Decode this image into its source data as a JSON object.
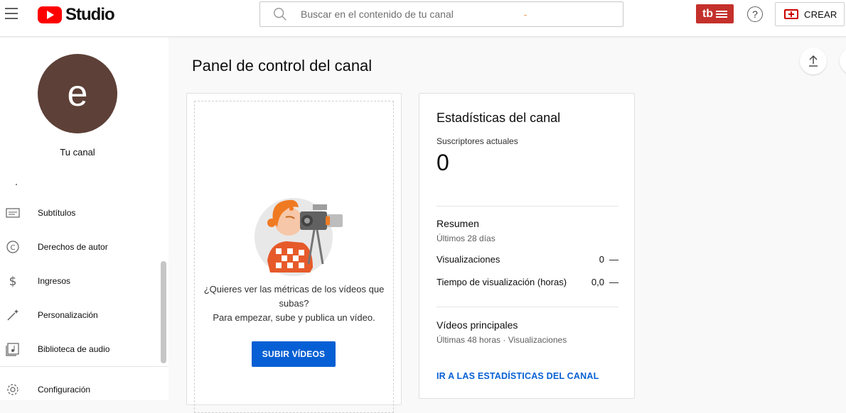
{
  "header": {
    "logo_text": "Studio",
    "search_placeholder": "Buscar en el contenido de tu canal",
    "extension_label": "tb",
    "create_label": "CREAR",
    "help_symbol": "?"
  },
  "sidebar": {
    "avatar_letter": "e",
    "avatar_color": "#5d4037",
    "channel_label": "Tu canal",
    "items": [
      {
        "label": "Subtítulos",
        "icon": "subtitles-icon"
      },
      {
        "label": "Derechos de autor",
        "icon": "copyright-icon"
      },
      {
        "label": "Ingresos",
        "icon": "dollar-icon"
      },
      {
        "label": "Personalización",
        "icon": "magic-wand-icon"
      },
      {
        "label": "Biblioteca de audio",
        "icon": "audio-library-icon"
      },
      {
        "label": "Configuración",
        "icon": "gear-icon"
      }
    ]
  },
  "main": {
    "title": "Panel de control del canal",
    "upload_card": {
      "line1": "¿Quieres ver las métricas de los vídeos que subas?",
      "line2": "Para empezar, sube y publica un vídeo.",
      "button_label": "SUBIR VÍDEOS"
    },
    "stats_card": {
      "title": "Estadísticas del canal",
      "subscribers_label": "Suscriptores actuales",
      "subscribers_value": "0",
      "summary_title": "Resumen",
      "summary_period": "Últimos 28 días",
      "rows": [
        {
          "label": "Visualizaciones",
          "value": "0",
          "trend": "—"
        },
        {
          "label": "Tiempo de visualización (horas)",
          "value": "0,0",
          "trend": "—"
        }
      ],
      "top_videos_title": "Vídeos principales",
      "top_videos_period": "Últimas 48 horas · Visualizaciones",
      "link_label": "IR A LAS ESTADÍSTICAS DEL CANAL"
    }
  },
  "colors": {
    "brand_red": "#ff0000",
    "link_blue": "#065fd4",
    "extension_red": "#c4302b"
  }
}
